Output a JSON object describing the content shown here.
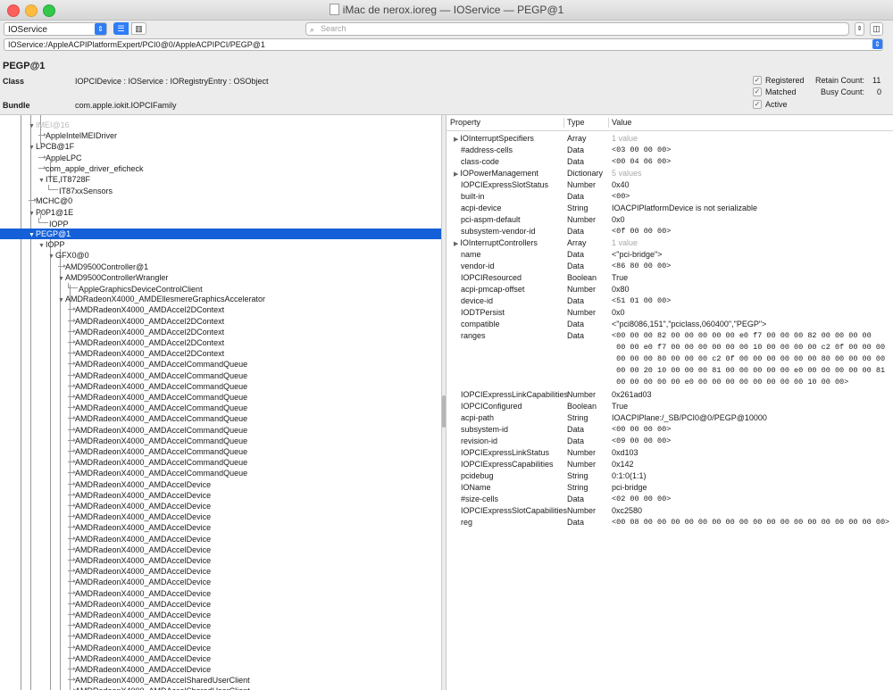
{
  "window": {
    "title": "iMac de nerox.ioreg — IOService — PEGP@1"
  },
  "toolbar": {
    "plane": "IOService",
    "search_placeholder": "Search",
    "path": "IOService:/AppleACPIPlatformExpert/PCI0@0/AppleACPIPCI/PEGP@1"
  },
  "object": {
    "name": "PEGP@1",
    "class_label": "Class",
    "class_value": "IOPCIDevice : IOService : IORegistryEntry : OSObject",
    "bundle_label": "Bundle",
    "bundle_value": "com.apple.iokit.IOPCIFamily",
    "registered_label": "Registered",
    "matched_label": "Matched",
    "active_label": "Active",
    "retain_label": "Retain Count:",
    "retain_value": "11",
    "busy_label": "Busy Count:",
    "busy_value": "0"
  },
  "tree": {
    "nodes": [
      {
        "label": "IMEI@16",
        "glyph": "disc"
      },
      {
        "label": "AppleIntelMEIDriver",
        "glyph": "arrow"
      },
      {
        "label": "LPCB@1F",
        "glyph": "disc"
      },
      {
        "label": "AppleLPC",
        "glyph": "arrow"
      },
      {
        "label": "com_apple_driver_eficheck",
        "glyph": "arrow"
      },
      {
        "label": "ITE,IT8728F",
        "glyph": "disc"
      },
      {
        "label": "IT87xxSensors",
        "glyph": "hook"
      },
      {
        "label": "MCHC@0",
        "glyph": "arrow"
      },
      {
        "label": "P0P1@1E",
        "glyph": "disc"
      },
      {
        "label": "IOPP",
        "glyph": "hook"
      },
      {
        "label": "PEGP@1",
        "glyph": "disc"
      },
      {
        "label": "IOPP",
        "glyph": "disc"
      },
      {
        "label": "GFX0@0",
        "glyph": "disc"
      },
      {
        "label": "AMD9500Controller@1",
        "glyph": "arrow"
      },
      {
        "label": "AMD9500ControllerWrangler",
        "glyph": "disc"
      },
      {
        "label": "AppleGraphicsDeviceControlClient",
        "glyph": "hook"
      },
      {
        "label": "AMDRadeonX4000_AMDEllesmereGraphicsAccelerator",
        "glyph": "disc"
      },
      {
        "label": "AMDRadeonX4000_AMDAccel2DContext",
        "glyph": "arrow"
      },
      {
        "label": "AMDRadeonX4000_AMDAccel2DContext",
        "glyph": "arrow"
      },
      {
        "label": "AMDRadeonX4000_AMDAccel2DContext",
        "glyph": "arrow"
      },
      {
        "label": "AMDRadeonX4000_AMDAccel2DContext",
        "glyph": "arrow"
      },
      {
        "label": "AMDRadeonX4000_AMDAccel2DContext",
        "glyph": "arrow"
      },
      {
        "label": "AMDRadeonX4000_AMDAccelCommandQueue",
        "glyph": "arrow"
      },
      {
        "label": "AMDRadeonX4000_AMDAccelCommandQueue",
        "glyph": "arrow"
      },
      {
        "label": "AMDRadeonX4000_AMDAccelCommandQueue",
        "glyph": "arrow"
      },
      {
        "label": "AMDRadeonX4000_AMDAccelCommandQueue",
        "glyph": "arrow"
      },
      {
        "label": "AMDRadeonX4000_AMDAccelCommandQueue",
        "glyph": "arrow"
      },
      {
        "label": "AMDRadeonX4000_AMDAccelCommandQueue",
        "glyph": "arrow"
      },
      {
        "label": "AMDRadeonX4000_AMDAccelCommandQueue",
        "glyph": "arrow"
      },
      {
        "label": "AMDRadeonX4000_AMDAccelCommandQueue",
        "glyph": "arrow"
      },
      {
        "label": "AMDRadeonX4000_AMDAccelCommandQueue",
        "glyph": "arrow"
      },
      {
        "label": "AMDRadeonX4000_AMDAccelCommandQueue",
        "glyph": "arrow"
      },
      {
        "label": "AMDRadeonX4000_AMDAccelCommandQueue",
        "glyph": "arrow"
      },
      {
        "label": "AMDRadeonX4000_AMDAccelDevice",
        "glyph": "arrow"
      },
      {
        "label": "AMDRadeonX4000_AMDAccelDevice",
        "glyph": "arrow"
      },
      {
        "label": "AMDRadeonX4000_AMDAccelDevice",
        "glyph": "arrow"
      },
      {
        "label": "AMDRadeonX4000_AMDAccelDevice",
        "glyph": "arrow"
      },
      {
        "label": "AMDRadeonX4000_AMDAccelDevice",
        "glyph": "arrow"
      },
      {
        "label": "AMDRadeonX4000_AMDAccelDevice",
        "glyph": "arrow"
      },
      {
        "label": "AMDRadeonX4000_AMDAccelDevice",
        "glyph": "arrow"
      },
      {
        "label": "AMDRadeonX4000_AMDAccelDevice",
        "glyph": "arrow"
      },
      {
        "label": "AMDRadeonX4000_AMDAccelDevice",
        "glyph": "arrow"
      },
      {
        "label": "AMDRadeonX4000_AMDAccelDevice",
        "glyph": "arrow"
      },
      {
        "label": "AMDRadeonX4000_AMDAccelDevice",
        "glyph": "arrow"
      },
      {
        "label": "AMDRadeonX4000_AMDAccelDevice",
        "glyph": "arrow"
      },
      {
        "label": "AMDRadeonX4000_AMDAccelDevice",
        "glyph": "arrow"
      },
      {
        "label": "AMDRadeonX4000_AMDAccelDevice",
        "glyph": "arrow"
      },
      {
        "label": "AMDRadeonX4000_AMDAccelDevice",
        "glyph": "arrow"
      },
      {
        "label": "AMDRadeonX4000_AMDAccelDevice",
        "glyph": "arrow"
      },
      {
        "label": "AMDRadeonX4000_AMDAccelDevice",
        "glyph": "arrow"
      },
      {
        "label": "AMDRadeonX4000_AMDAccelDevice",
        "glyph": "arrow"
      },
      {
        "label": "AMDRadeonX4000_AMDAccelSharedUserClient",
        "glyph": "arrow"
      },
      {
        "label": "AMDRadeonX4000_AMDAccelSharedUserClient",
        "glyph": "arrow"
      }
    ]
  },
  "props": {
    "headers": {
      "property": "Property",
      "type": "Type",
      "value": "Value"
    },
    "rows": [
      {
        "k": "IOInterruptSpecifiers",
        "t": "Array",
        "v": "1 value",
        "disc": true,
        "grey": true
      },
      {
        "k": "#address-cells",
        "t": "Data",
        "v": "<03 00 00 00>",
        "mono": true
      },
      {
        "k": "class-code",
        "t": "Data",
        "v": "<00 04 06 00>",
        "mono": true
      },
      {
        "k": "IOPowerManagement",
        "t": "Dictionary",
        "v": "5 values",
        "disc": true,
        "grey": true
      },
      {
        "k": "IOPCIExpressSlotStatus",
        "t": "Number",
        "v": "0x40"
      },
      {
        "k": "built-in",
        "t": "Data",
        "v": "<00>",
        "mono": true
      },
      {
        "k": "acpi-device",
        "t": "String",
        "v": "IOACPIPlatformDevice is not serializable"
      },
      {
        "k": "pci-aspm-default",
        "t": "Number",
        "v": "0x0"
      },
      {
        "k": "subsystem-vendor-id",
        "t": "Data",
        "v": "<0f 00 00 00>",
        "mono": true
      },
      {
        "k": "IOInterruptControllers",
        "t": "Array",
        "v": "1 value",
        "disc": true,
        "grey": true
      },
      {
        "k": "name",
        "t": "Data",
        "v": "<\"pci-bridge\">"
      },
      {
        "k": "vendor-id",
        "t": "Data",
        "v": "<86 80 00 00>",
        "mono": true
      },
      {
        "k": "IOPCIResourced",
        "t": "Boolean",
        "v": "True"
      },
      {
        "k": "acpi-pmcap-offset",
        "t": "Number",
        "v": "0x80"
      },
      {
        "k": "device-id",
        "t": "Data",
        "v": "<51 01 00 00>",
        "mono": true
      },
      {
        "k": "IODTPersist",
        "t": "Number",
        "v": "0x0"
      },
      {
        "k": "compatible",
        "t": "Data",
        "v": "<\"pci8086,151\",\"pciclass,060400\",\"PEGP\">"
      },
      {
        "k": "ranges",
        "t": "Data",
        "v": "<00 00 00 82 00 00 00 00 00 e0 f7 00 00 00 82 00 00 00 00\n 00 00 e0 f7 00 00 00 00 00 00 10 00 00 00 00 c2 0f 00 00 00\n 00 00 00 80 00 00 00 c2 0f 00 00 00 00 00 00 80 00 00 00 00\n 00 00 20 10 00 00 00 81 00 00 00 00 00 e0 00 00 00 00 00 81\n 00 00 00 00 00 e0 00 00 00 00 00 00 00 00 10 00 00>",
        "mono": true,
        "lines": 5
      },
      {
        "k": "IOPCIExpressLinkCapabilities",
        "t": "Number",
        "v": "0x261ad03"
      },
      {
        "k": "IOPCIConfigured",
        "t": "Boolean",
        "v": "True"
      },
      {
        "k": "acpi-path",
        "t": "String",
        "v": "IOACPIPlane:/_SB/PCI0@0/PEGP@10000"
      },
      {
        "k": "subsystem-id",
        "t": "Data",
        "v": "<00 00 00 00>",
        "mono": true
      },
      {
        "k": "revision-id",
        "t": "Data",
        "v": "<09 00 00 00>",
        "mono": true
      },
      {
        "k": "IOPCIExpressLinkStatus",
        "t": "Number",
        "v": "0xd103"
      },
      {
        "k": "IOPCIExpressCapabilities",
        "t": "Number",
        "v": "0x142"
      },
      {
        "k": "pcidebug",
        "t": "String",
        "v": "0:1:0(1:1)"
      },
      {
        "k": "IOName",
        "t": "String",
        "v": "pci-bridge"
      },
      {
        "k": "#size-cells",
        "t": "Data",
        "v": "<02 00 00 00>",
        "mono": true
      },
      {
        "k": "IOPCIExpressSlotCapabilities",
        "t": "Number",
        "v": "0xc2580"
      },
      {
        "k": "reg",
        "t": "Data",
        "v": "<00 08 00 00 00 00 00 00 00 00 00 00 00 00 00 00 00 00 00 00>",
        "mono": true
      }
    ]
  },
  "colors": {
    "selection": "#1560d8",
    "accent": "#2f7df6"
  }
}
